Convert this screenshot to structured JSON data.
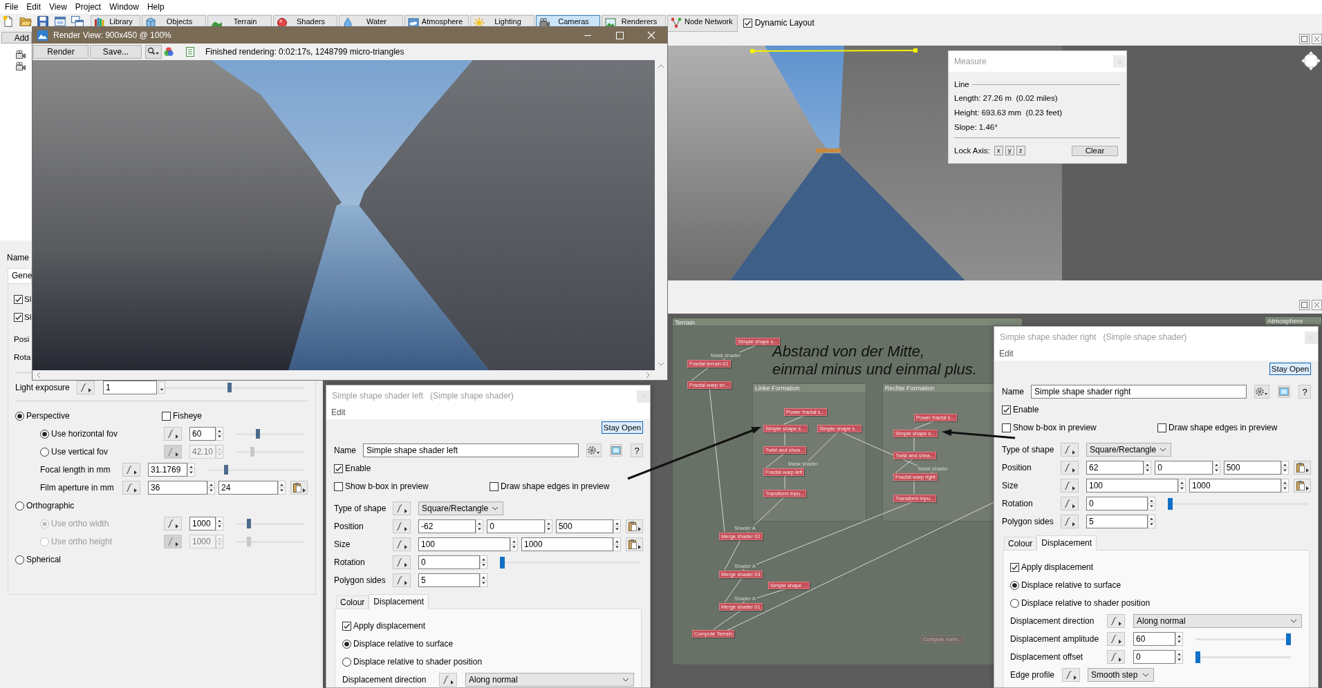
{
  "menu_bar": {
    "items": [
      "File",
      "Edit",
      "View",
      "Project",
      "Window",
      "Help"
    ]
  },
  "toolbar": {
    "buttons": [
      {
        "label": "Library",
        "selected": false
      },
      {
        "label": "Objects",
        "selected": false
      },
      {
        "label": "Terrain",
        "selected": false
      },
      {
        "label": "Shaders",
        "selected": false
      },
      {
        "label": "Water",
        "selected": false
      },
      {
        "label": "Atmosphere",
        "selected": false
      },
      {
        "label": "Lighting",
        "selected": false
      },
      {
        "label": "Cameras",
        "selected": true
      },
      {
        "label": "Renderers",
        "selected": false
      },
      {
        "label": "Node Network",
        "selected": false
      }
    ],
    "dynamic_layout": {
      "label": "Dynamic Layout",
      "checked": true
    }
  },
  "side_panel": {
    "add_button": "Add",
    "name_label": "Name",
    "tab": "Gene",
    "checkboxes": [
      {
        "label": "Sl",
        "checked": true
      },
      {
        "label": "Sl",
        "checked": true
      }
    ],
    "field_labels": [
      "Posi",
      "Rota"
    ],
    "light_exposure": {
      "label": "Light exposure",
      "value": "1",
      "level": 0.46
    },
    "projections": [
      {
        "label": "Perspective",
        "selected": true,
        "fisheye": {
          "label": "Fisheye",
          "checked": false
        },
        "children": [
          {
            "kind": "option",
            "label": "Use horizontal fov",
            "selected": true,
            "disabled": false,
            "value": "60",
            "value_disabled": false,
            "level": 0.31
          },
          {
            "kind": "option",
            "label": "Use vertical fov",
            "selected": false,
            "disabled": false,
            "value": "42.10",
            "value_disabled": true,
            "level": 0.23
          },
          {
            "kind": "value",
            "label": "Focal length in mm",
            "value": "31.1769",
            "level": 0.17
          },
          {
            "kind": "pair",
            "label": "Film aperture in mm",
            "values": [
              "36",
              "24"
            ]
          }
        ]
      },
      {
        "label": "Orthographic",
        "selected": false,
        "children": [
          {
            "kind": "option",
            "label": "Use ortho width",
            "selected": true,
            "disabled": true,
            "value": "1000",
            "value_disabled": false,
            "level": 0.17
          },
          {
            "kind": "option",
            "label": "Use ortho height",
            "selected": false,
            "disabled": true,
            "value": "1000",
            "value_disabled": true,
            "level": 0.17
          }
        ]
      },
      {
        "label": "Spherical",
        "selected": false
      }
    ]
  },
  "render_view": {
    "title": "Render View: 900x450 @ 100%",
    "buttons": [
      "Render",
      "Save..."
    ],
    "status": "Finished rendering: 0:02:17s, 1248799 micro-triangles"
  },
  "measure": {
    "title": "Measure",
    "group": "Line",
    "readings": [
      "Length: 27.26 m  (0.02 miles)",
      "Height: 693.63 mm  (0.23 feet)",
      "Slope: 1.46°"
    ],
    "lock_label": "Lock Axis:",
    "axes": [
      "x",
      "y",
      "z"
    ],
    "clear": "Clear"
  },
  "node_network": {
    "groups": [
      {
        "title": "Terrain",
        "nodes": [
          {
            "label": "Simple shape s...",
            "disabled": false
          },
          {
            "label": "Fractal terrain 01",
            "port": "Mask shader",
            "disabled": false
          },
          {
            "label": "Fractal warp sh...",
            "disabled": false
          },
          {
            "label": "Merge shader 02",
            "port": "Shader A",
            "disabled": false
          },
          {
            "label": "Merge shader 03",
            "port": "Shader A",
            "disabled": false
          },
          {
            "label": "Simple shape ...",
            "disabled": false
          },
          {
            "label": "Merge shader 01",
            "port": "Shader A",
            "disabled": false
          },
          {
            "label": "Compute Terrain",
            "disabled": false
          },
          {
            "label": "Compute norm...",
            "disabled": true
          }
        ],
        "groups": [
          {
            "title": "Linke Formation",
            "nodes": [
              {
                "label": "Power fractal s...",
                "disabled": false
              },
              {
                "label": "Simple shape s...",
                "disabled": false
              },
              {
                "label": "Simple shape s...",
                "disabled": false
              },
              {
                "label": "Twist and shea...",
                "disabled": false
              },
              {
                "label": "Fractal warp left",
                "port": "Mask shader",
                "disabled": false
              },
              {
                "label": "Transform inpu...",
                "disabled": false
              }
            ]
          },
          {
            "title": "Rechte Formation",
            "nodes": [
              {
                "label": "Power fractal s...",
                "disabled": false
              },
              {
                "label": "Simple shape s...",
                "disabled": false
              },
              {
                "label": "Twist and shea...",
                "disabled": false
              },
              {
                "label": "Fractal warp right",
                "port": "Mask shader",
                "disabled": false
              },
              {
                "label": "Transform inpu...",
                "disabled": false
              }
            ]
          }
        ]
      },
      {
        "title": "Atmosphere"
      }
    ],
    "annotation": "Abstand von der Mitte,\neinmal minus und einmal plus."
  },
  "shader_dialogs": [
    {
      "title": "Simple shape shader left",
      "type": "(Simple shape shader)",
      "menu": "Edit",
      "stay_open": "Stay Open",
      "name_label": "Name",
      "name_value": "Simple shape shader left",
      "help": "?",
      "enable": {
        "label": "Enable",
        "checked": true
      },
      "options": [
        {
          "label": "Show b-box in preview",
          "checked": false
        },
        {
          "label": "Draw shape edges in preview",
          "checked": false
        }
      ],
      "rows": [
        {
          "kind": "select",
          "label": "Type of shape",
          "value": "Square/Rectangle"
        },
        {
          "kind": "vector",
          "label": "Position",
          "values": [
            "-62",
            "0",
            "500"
          ]
        },
        {
          "kind": "vector",
          "label": "Size",
          "values": [
            "100",
            "1000"
          ]
        },
        {
          "kind": "slider",
          "label": "Rotation",
          "value": "0",
          "level": 0
        },
        {
          "kind": "number",
          "label": "Polygon sides",
          "value": "5"
        }
      ],
      "tabs": [
        {
          "label": "Colour",
          "selected": false
        },
        {
          "label": "Displacement",
          "selected": true
        }
      ],
      "apply": {
        "label": "Apply displacement",
        "checked": true
      },
      "modes": [
        {
          "label": "Displace relative to surface",
          "selected": true
        },
        {
          "label": "Displace relative to shader position",
          "selected": false
        }
      ],
      "displacement_rows": [
        {
          "kind": "selectwide",
          "label": "Displacement direction",
          "value": "Along normal"
        }
      ]
    },
    {
      "title": "Simple shape shader right",
      "type": "(Simple shape shader)",
      "menu": "Edit",
      "stay_open": "Stay Open",
      "name_label": "Name",
      "name_value": "Simple shape shader right",
      "help": "?",
      "enable": {
        "label": "Enable",
        "checked": true
      },
      "options": [
        {
          "label": "Show b-box in preview",
          "checked": false
        },
        {
          "label": "Draw shape edges in preview",
          "checked": false
        }
      ],
      "rows": [
        {
          "kind": "select",
          "label": "Type of shape",
          "value": "Square/Rectangle"
        },
        {
          "kind": "vector",
          "label": "Position",
          "values": [
            "62",
            "0",
            "500"
          ]
        },
        {
          "kind": "vector",
          "label": "Size",
          "values": [
            "100",
            "1000"
          ]
        },
        {
          "kind": "slider",
          "label": "Rotation",
          "value": "0",
          "level": 0
        },
        {
          "kind": "number",
          "label": "Polygon sides",
          "value": "5"
        }
      ],
      "tabs": [
        {
          "label": "Colour",
          "selected": false
        },
        {
          "label": "Displacement",
          "selected": true
        }
      ],
      "apply": {
        "label": "Apply displacement",
        "checked": true
      },
      "modes": [
        {
          "label": "Displace relative to surface",
          "selected": true
        },
        {
          "label": "Displace relative to shader position",
          "selected": false
        }
      ],
      "displacement_rows": [
        {
          "kind": "selectwide",
          "label": "Displacement direction",
          "value": "Along normal"
        },
        {
          "kind": "slider",
          "label": "Displacement amplitude",
          "value": "60",
          "level": 1
        },
        {
          "kind": "slider",
          "label": "Displacement offset",
          "value": "0",
          "level": 0
        },
        {
          "kind": "select",
          "label": "Edge profile",
          "value": "Smooth step"
        }
      ]
    }
  ]
}
